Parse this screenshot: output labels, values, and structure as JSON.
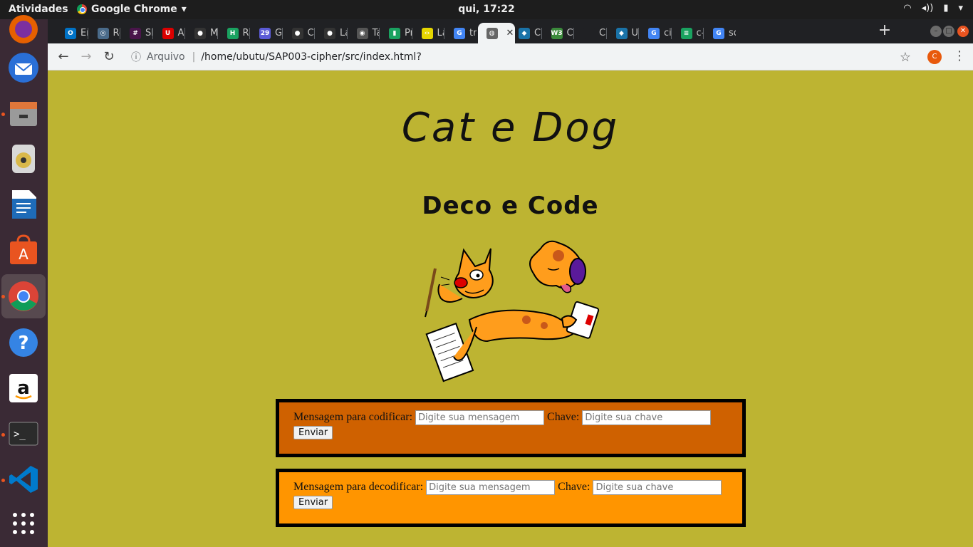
{
  "topbar": {
    "activities": "Atividades",
    "app_name": "Google Chrome",
    "clock": "qui, 17:22"
  },
  "dock": {
    "items": [
      {
        "name": "firefox",
        "color": "#e66000"
      },
      {
        "name": "thunderbird",
        "color": "#2a6fd6"
      },
      {
        "name": "files",
        "color": "#8a8a8a"
      },
      {
        "name": "rhythmbox",
        "color": "#d9b84a"
      },
      {
        "name": "libreoffice-writer",
        "color": "#1e6bb8"
      },
      {
        "name": "software",
        "color": "#e95420"
      },
      {
        "name": "chrome",
        "color": "#4285f4"
      },
      {
        "name": "help",
        "color": "#3584e4"
      },
      {
        "name": "amazon",
        "color": "#ffffff"
      },
      {
        "name": "terminal",
        "color": "#2b2b2b"
      },
      {
        "name": "vscode",
        "color": "#007acc"
      },
      {
        "name": "show-apps",
        "color": "#ffffff"
      }
    ]
  },
  "tabs": [
    {
      "label": "En",
      "fav": "O",
      "color": "#0072c6"
    },
    {
      "label": "Re",
      "fav": "◎",
      "color": "#4a6b8a"
    },
    {
      "label": "Sl",
      "fav": "#",
      "color": "#4a154b"
    },
    {
      "label": "Ap",
      "fav": "U",
      "color": "#d00"
    },
    {
      "label": "M",
      "fav": "●",
      "color": "#333"
    },
    {
      "label": "Re",
      "fav": "H",
      "color": "#1aa260"
    },
    {
      "label": "Gc",
      "fav": "29",
      "color": "#5b5bd6"
    },
    {
      "label": "Ca",
      "fav": "●",
      "color": "#333"
    },
    {
      "label": "La",
      "fav": "●",
      "color": "#333"
    },
    {
      "label": "Ta",
      "fav": "◉",
      "color": "#555"
    },
    {
      "label": "Pr",
      "fav": "▮",
      "color": "#1aa260"
    },
    {
      "label": "La",
      "fav": "‹›",
      "color": "#e6d600"
    },
    {
      "label": "tra",
      "fav": "G",
      "color": "#4285f4"
    },
    {
      "label": "",
      "fav": "◍",
      "color": "#666"
    },
    {
      "label": "CS",
      "fav": "◆",
      "color": "#1a73a8"
    },
    {
      "label": "CS",
      "fav": "W3",
      "color": "#3b8a3b"
    },
    {
      "label": "Ca",
      "fav": "",
      "color": "#202124"
    },
    {
      "label": "Us",
      "fav": "◆",
      "color": "#1a73a8"
    },
    {
      "label": "cif",
      "fav": "G",
      "color": "#4285f4"
    },
    {
      "label": "c-",
      "fav": "≡",
      "color": "#1aa260"
    },
    {
      "label": "so",
      "fav": "G",
      "color": "#4285f4"
    }
  ],
  "toolbar": {
    "scheme": "Arquivo",
    "url": "/home/ubutu/SAP003-cipher/src/index.html?",
    "profile_initial": "C"
  },
  "page": {
    "title": "Cat e Dog",
    "subtitle": "Deco e Code",
    "encode": {
      "label": "Mensagem para codificar:",
      "message_placeholder": "Digite sua mensagem",
      "key_label": "Chave:",
      "key_placeholder": "Digite sua chave",
      "button": "Enviar"
    },
    "decode": {
      "label": "Mensagem para decodificar:",
      "message_placeholder": "Digite sua mensagem",
      "key_label": "Chave:",
      "key_placeholder": "Digite sua chave",
      "button": "Enviar"
    }
  }
}
